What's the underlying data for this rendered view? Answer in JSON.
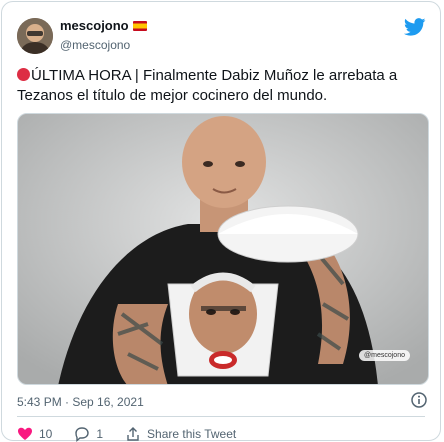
{
  "author": {
    "display_name": "mescojono",
    "username": "@mescojono"
  },
  "icons": {
    "avatar": "avatar",
    "flag": "spain-flag-icon",
    "brand": "twitter-bird-icon",
    "alert": "red-circle-icon",
    "info": "info-icon",
    "reply": "reply-icon",
    "like": "heart-icon",
    "share": "share-icon"
  },
  "tweet": {
    "text": "ÚLTIMA HORA | Finalmente Dabiz Muñoz le arrebata a Tezanos el título de mejor cocinero del mundo.",
    "media_watermark": "@mescojono",
    "timestamp": "5:43 PM · Sep 16, 2021"
  },
  "actions": {
    "like_count": "10",
    "reply_count": "1",
    "share_label": "Share this Tweet"
  },
  "colors": {
    "brand": "#1d9bf0",
    "alert_red": "#dd2e44",
    "border": "#cfd9de",
    "secondary_text": "#536471"
  }
}
